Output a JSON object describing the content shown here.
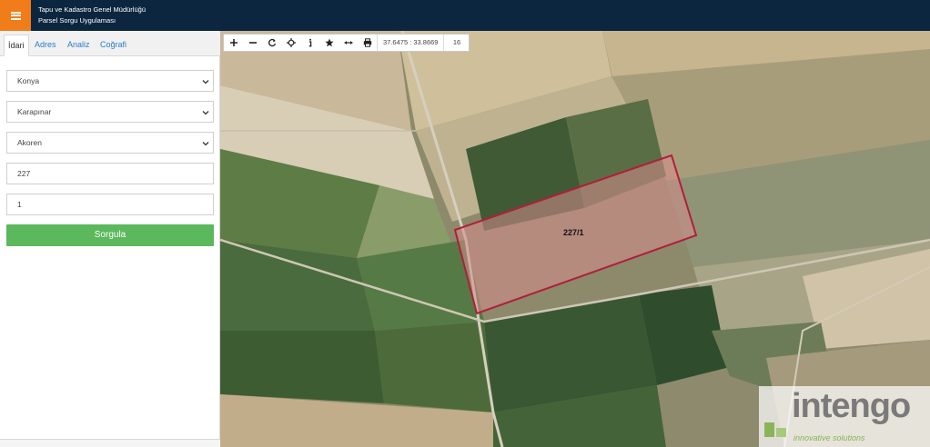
{
  "header": {
    "title_line1": "Tapu ve Kadastro Genel Müdürlüğü",
    "title_line2": "Parsel Sorgu Uygulaması",
    "menu_icon": "hamburger-icon",
    "bg_color": "#0c2640",
    "accent_color": "#f07c1a"
  },
  "tabs": [
    {
      "label": "İdari",
      "active": true
    },
    {
      "label": "Adres",
      "active": false
    },
    {
      "label": "Analiz",
      "active": false
    },
    {
      "label": "Coğrafi",
      "active": false
    }
  ],
  "form": {
    "province": "Konya",
    "district": "Karapınar",
    "neighborhood": "Akoren",
    "block_no": "227",
    "parcel_no": "1",
    "submit_label": "Sorgula",
    "submit_color": "#5cb85c"
  },
  "toolbar": {
    "tools": [
      "zoom-in-icon",
      "zoom-out-icon",
      "refresh-icon",
      "locate-icon",
      "info-icon",
      "star-icon",
      "measure-icon",
      "print-icon"
    ],
    "coordinates": "37.6475 : 33.8669",
    "zoom": "16"
  },
  "map": {
    "parcel_label": "227/1",
    "parcel_color": "#b01e3c"
  },
  "watermark": {
    "brand": "intengo",
    "tagline": "innovative solutions"
  }
}
